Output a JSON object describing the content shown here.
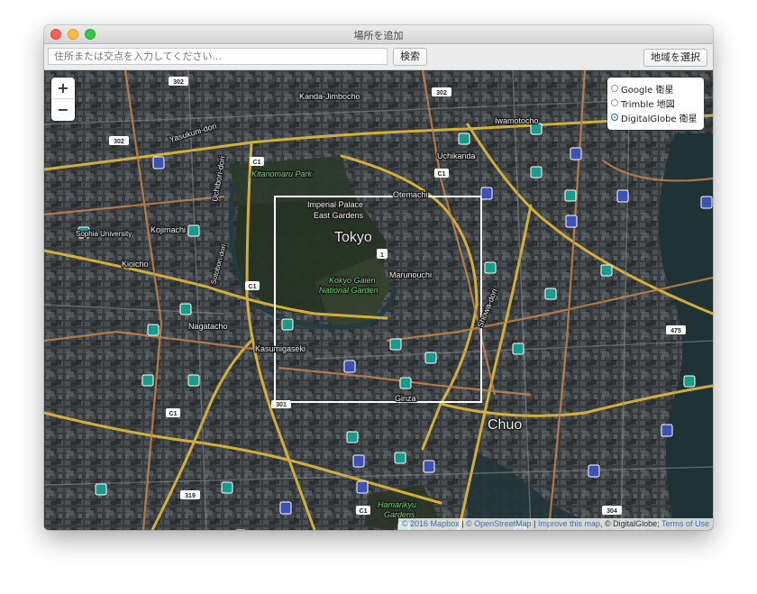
{
  "window": {
    "title": "場所を追加"
  },
  "toolbar": {
    "search_placeholder": "住所または交点を入力してください...",
    "search_button": "検索",
    "region_button": "地域を選択"
  },
  "map": {
    "zoom_in": "+",
    "zoom_out": "−",
    "layers": [
      {
        "label": "Google 衛星",
        "selected": false
      },
      {
        "label": "Trimble 地図",
        "selected": false
      },
      {
        "label": "DigitalGlobe 衛星",
        "selected": true
      }
    ],
    "labels": {
      "kanda_jimbocho": "Kanda-Jimbocho",
      "yasukuni_dori": "Yasukuni-dori",
      "kitanomaru_park": "Kitanomaru Park",
      "uchikanda": "Uchikanda",
      "iwamotocho": "Iwamotocho",
      "imperial_palace": "Imperial Palace",
      "east_gardens": "East Gardens",
      "otemachi": "Otemachi",
      "tokyo": "Tokyo",
      "sophia_university": "Sophia University",
      "kojimachi": "Kojimachi",
      "kioicho": "Kioicho",
      "marunouchi": "Marunouchi",
      "kokyo_gaien": "Kokyo Gaien",
      "national_garden": "National Garden",
      "showa_dori": "Showa-dori",
      "nagatacho": "Nagatacho",
      "kasumigaseki": "Kasumigaseki",
      "ginza": "Ginza",
      "chuo": "Chuo",
      "hamarikyu": "Hamarikyu",
      "gardens": "Gardens",
      "uchibori_dori": "Uchibori-dori",
      "sotobori_dori": "Sotobori-dori"
    },
    "shields": {
      "r302a": "302",
      "r302b": "302",
      "r302c": "302",
      "c1a": "C1",
      "c1b": "C1",
      "c1c": "C1",
      "c1d": "C1",
      "c1e": "C1",
      "r1": "1",
      "r475": "475",
      "r319": "319",
      "r304": "304",
      "r301": "301"
    }
  },
  "attribution": {
    "mapbox": "© 2016 Mapbox",
    "sep1": " | ",
    "osm": "© OpenStreetMap",
    "sep2": " | ",
    "improve": "Improve this map",
    "digitalglobe": ", © DigitalGlobe; ",
    "terms": "Terms of Use"
  },
  "colors": {
    "road_major": "#d9b53a",
    "road_minor": "#c4834a",
    "water": "#253a3e",
    "park": "#2c3a2a",
    "city": "#3a3e40",
    "selection": "#ffffff",
    "station": "#1a9a8a",
    "subway": "#3f51b5"
  }
}
